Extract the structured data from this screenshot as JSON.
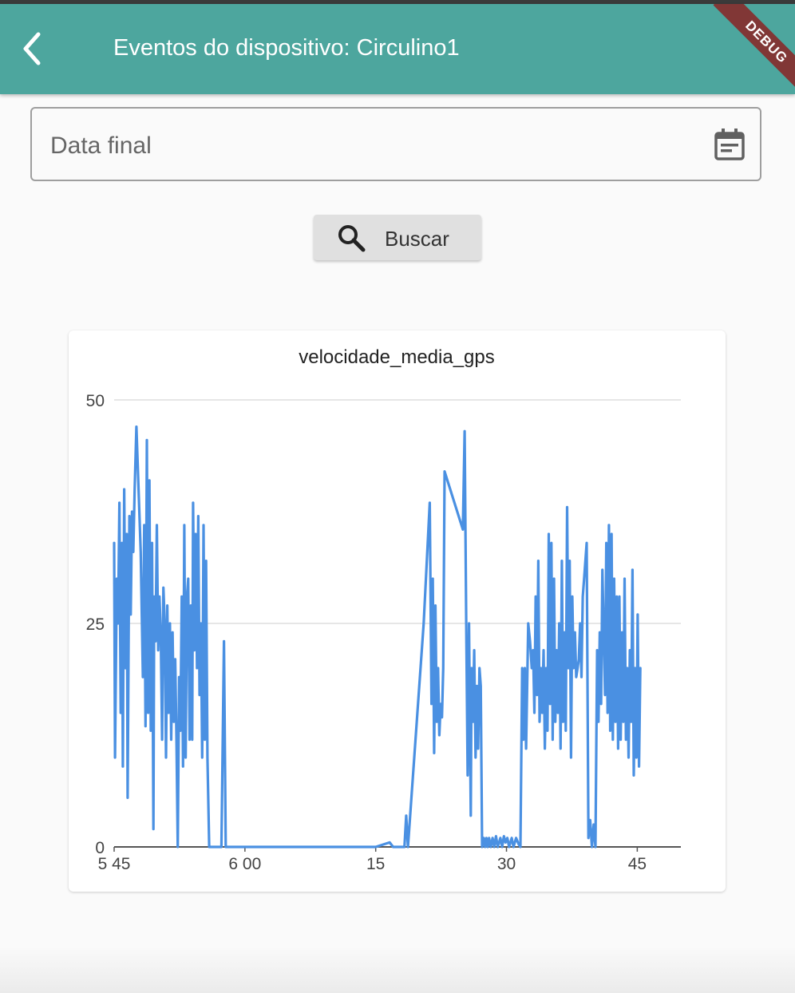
{
  "appbar": {
    "title": "Eventos do dispositivo: Circulino1",
    "back_icon": "chevron-left-icon",
    "color": "#4da69e",
    "debug_banner": "DEBUG"
  },
  "date_field": {
    "label": "Data final",
    "icon": "calendar-icon"
  },
  "search_button": {
    "label": "Buscar",
    "icon": "search-icon"
  },
  "chart_data": {
    "type": "line",
    "title": "velocidade_media_gps",
    "xlabel": "",
    "ylabel": "",
    "ylim": [
      0,
      50
    ],
    "xlim": [
      0,
      65
    ],
    "y_ticks": [
      "0",
      "25",
      "50"
    ],
    "x_ticks": [
      {
        "value": 0,
        "label": "5 45"
      },
      {
        "value": 15,
        "label": "6 00"
      },
      {
        "value": 30,
        "label": "15"
      },
      {
        "value": 45,
        "label": "30"
      },
      {
        "value": 60,
        "label": "45"
      }
    ],
    "grid": true,
    "line_color": "#4a90e2",
    "series": [
      {
        "values": [
          [
            0.0,
            34.0
          ],
          [
            0.1,
            10.0
          ],
          [
            0.3,
            30.0
          ],
          [
            0.45,
            25.0
          ],
          [
            0.6,
            38.5
          ],
          [
            0.75,
            15.0
          ],
          [
            0.9,
            34.0
          ],
          [
            1.0,
            9.0
          ],
          [
            1.15,
            40.0
          ],
          [
            1.3,
            20.0
          ],
          [
            1.45,
            35.0
          ],
          [
            1.55,
            5.5
          ],
          [
            1.75,
            37.0
          ],
          [
            1.9,
            26.0
          ],
          [
            2.05,
            37.5
          ],
          [
            2.2,
            33.0
          ],
          [
            2.35,
            40.0
          ],
          [
            2.55,
            47.0
          ],
          [
            2.8,
            40.0
          ],
          [
            3.05,
            33.0
          ],
          [
            3.3,
            19.0
          ],
          [
            3.45,
            36.0
          ],
          [
            3.6,
            13.5
          ],
          [
            3.75,
            45.5
          ],
          [
            3.9,
            15.0
          ],
          [
            4.05,
            41.0
          ],
          [
            4.2,
            13.0
          ],
          [
            4.35,
            34.0
          ],
          [
            4.5,
            2.0
          ],
          [
            4.6,
            28.0
          ],
          [
            4.75,
            23.0
          ],
          [
            4.9,
            36.0
          ],
          [
            5.05,
            22.0
          ],
          [
            5.2,
            28.0
          ],
          [
            5.35,
            24.0
          ],
          [
            5.5,
            12.0
          ],
          [
            5.65,
            29.0
          ],
          [
            5.8,
            25.0
          ],
          [
            5.95,
            10.0
          ],
          [
            6.1,
            27.0
          ],
          [
            6.25,
            15.0
          ],
          [
            6.4,
            25.0
          ],
          [
            6.55,
            12.0
          ],
          [
            6.7,
            24.0
          ],
          [
            6.85,
            14.0
          ],
          [
            7.0,
            21.0
          ],
          [
            7.15,
            12.0
          ],
          [
            7.3,
            0.0
          ],
          [
            7.45,
            19.0
          ],
          [
            7.6,
            13.0
          ],
          [
            7.75,
            28.0
          ],
          [
            7.9,
            9.0
          ],
          [
            8.05,
            36.0
          ],
          [
            8.2,
            10.0
          ],
          [
            8.35,
            28.0
          ],
          [
            8.5,
            30.0
          ],
          [
            8.65,
            12.0
          ],
          [
            8.8,
            27.0
          ],
          [
            8.95,
            12.0
          ],
          [
            9.05,
            38.5
          ],
          [
            9.2,
            22.0
          ],
          [
            9.35,
            35.0
          ],
          [
            9.5,
            20.0
          ],
          [
            9.65,
            37.0
          ],
          [
            9.8,
            17.0
          ],
          [
            9.95,
            25.0
          ],
          [
            10.1,
            10.0
          ],
          [
            10.25,
            36.0
          ],
          [
            10.4,
            12.0
          ],
          [
            10.55,
            32.0
          ],
          [
            10.7,
            10.0
          ],
          [
            10.9,
            0.0
          ],
          [
            11.4,
            0.0
          ],
          [
            11.7,
            0.0
          ],
          [
            12.0,
            0.0
          ],
          [
            12.3,
            0.0
          ],
          [
            12.6,
            23.0
          ],
          [
            12.8,
            0.0
          ],
          [
            13.5,
            0.0
          ],
          [
            16.0,
            0.0
          ],
          [
            20.0,
            0.0
          ],
          [
            25.0,
            0.0
          ],
          [
            29.0,
            0.0
          ],
          [
            30.0,
            0.0
          ],
          [
            31.6,
            0.5
          ],
          [
            32.0,
            0.0
          ],
          [
            33.3,
            0.0
          ],
          [
            33.5,
            3.5
          ],
          [
            33.7,
            0.0
          ],
          [
            35.5,
            25.0
          ],
          [
            36.2,
            38.5
          ],
          [
            36.4,
            16.0
          ],
          [
            36.55,
            30.0
          ],
          [
            36.7,
            10.5
          ],
          [
            36.85,
            27.0
          ],
          [
            37.0,
            14.0
          ],
          [
            37.15,
            20.0
          ],
          [
            37.3,
            12.5
          ],
          [
            37.45,
            16.0
          ],
          [
            37.6,
            14.5
          ],
          [
            37.75,
            20.0
          ],
          [
            37.9,
            42.0
          ],
          [
            40.0,
            35.5
          ],
          [
            40.2,
            46.5
          ],
          [
            40.4,
            23.0
          ],
          [
            40.55,
            8.0
          ],
          [
            40.7,
            25.0
          ],
          [
            40.9,
            3.5
          ],
          [
            41.0,
            20.0
          ],
          [
            41.15,
            14.0
          ],
          [
            41.3,
            22.0
          ],
          [
            41.45,
            10.0
          ],
          [
            41.6,
            18.0
          ],
          [
            41.75,
            11.0
          ],
          [
            41.9,
            20.0
          ],
          [
            42.05,
            18.0
          ],
          [
            42.2,
            0.0
          ],
          [
            42.4,
            1.0
          ],
          [
            42.55,
            0.0
          ],
          [
            42.7,
            1.0
          ],
          [
            42.85,
            0.0
          ],
          [
            43.0,
            1.0
          ],
          [
            43.2,
            0.0
          ],
          [
            43.4,
            1.0
          ],
          [
            43.6,
            0.0
          ],
          [
            43.8,
            1.2
          ],
          [
            44.0,
            0.0
          ],
          [
            44.3,
            1.0
          ],
          [
            44.5,
            0.0
          ],
          [
            44.7,
            1.2
          ],
          [
            44.9,
            0.5
          ],
          [
            45.1,
            1.0
          ],
          [
            45.3,
            0.0
          ],
          [
            45.6,
            1.0
          ],
          [
            45.8,
            0.0
          ],
          [
            46.1,
            1.0
          ],
          [
            46.4,
            0.3
          ],
          [
            46.6,
            0.0
          ],
          [
            46.8,
            20.0
          ],
          [
            46.95,
            12.0
          ],
          [
            47.1,
            20.0
          ],
          [
            47.25,
            11.0
          ],
          [
            47.5,
            25.0
          ],
          [
            47.7,
            23.0
          ],
          [
            47.9,
            20.0
          ],
          [
            48.05,
            22.0
          ],
          [
            48.2,
            15.0
          ],
          [
            48.35,
            28.0
          ],
          [
            48.5,
            17.0
          ],
          [
            48.65,
            32.0
          ],
          [
            48.8,
            14.0
          ],
          [
            48.95,
            20.0
          ],
          [
            49.1,
            15.0
          ],
          [
            49.25,
            22.0
          ],
          [
            49.4,
            11.0
          ],
          [
            49.55,
            20.0
          ],
          [
            49.7,
            13.0
          ],
          [
            49.85,
            35.0
          ],
          [
            50.0,
            16.0
          ],
          [
            50.15,
            34.0
          ],
          [
            50.3,
            12.0
          ],
          [
            50.45,
            30.0
          ],
          [
            50.6,
            14.0
          ],
          [
            50.75,
            22.0
          ],
          [
            50.9,
            15.0
          ],
          [
            51.05,
            25.0
          ],
          [
            51.2,
            11.0
          ],
          [
            51.35,
            32.0
          ],
          [
            51.5,
            14.0
          ],
          [
            51.65,
            24.0
          ],
          [
            51.8,
            13.0
          ],
          [
            51.95,
            38.0
          ],
          [
            52.1,
            20.0
          ],
          [
            52.25,
            32.0
          ],
          [
            52.4,
            10.0
          ],
          [
            52.55,
            28.0
          ],
          [
            52.7,
            20.0
          ],
          [
            52.85,
            24.0
          ],
          [
            53.0,
            19.0
          ],
          [
            53.15,
            20.0
          ],
          [
            53.3,
            21.0
          ],
          [
            53.45,
            25.0
          ],
          [
            53.6,
            19.0
          ],
          [
            53.75,
            28.0
          ],
          [
            53.9,
            30.0
          ],
          [
            54.05,
            32.0
          ],
          [
            54.2,
            34.0
          ],
          [
            54.4,
            1.0
          ],
          [
            54.6,
            3.0
          ],
          [
            54.8,
            0.0
          ],
          [
            55.0,
            2.5
          ],
          [
            55.2,
            0.0
          ],
          [
            55.4,
            22.0
          ],
          [
            55.55,
            14.0
          ],
          [
            55.7,
            24.0
          ],
          [
            55.85,
            16.0
          ],
          [
            56.0,
            31.0
          ],
          [
            56.15,
            24.0
          ],
          [
            56.3,
            17.0
          ],
          [
            56.45,
            34.0
          ],
          [
            56.6,
            15.0
          ],
          [
            56.75,
            36.0
          ],
          [
            56.9,
            13.0
          ],
          [
            57.05,
            35.0
          ],
          [
            57.2,
            12.0
          ],
          [
            57.35,
            30.0
          ],
          [
            57.5,
            14.0
          ],
          [
            57.65,
            28.0
          ],
          [
            57.8,
            11.0
          ],
          [
            57.95,
            28.0
          ],
          [
            58.1,
            12.0
          ],
          [
            58.25,
            24.0
          ],
          [
            58.4,
            14.0
          ],
          [
            58.55,
            30.0
          ],
          [
            58.7,
            12.0
          ],
          [
            58.85,
            20.0
          ],
          [
            59.0,
            10.0
          ],
          [
            59.15,
            22.0
          ],
          [
            59.3,
            14.0
          ],
          [
            59.45,
            31.0
          ],
          [
            59.6,
            8.0
          ],
          [
            59.75,
            20.0
          ],
          [
            59.9,
            10.0
          ],
          [
            60.05,
            26.0
          ],
          [
            60.2,
            9.0
          ],
          [
            60.35,
            20.0
          ]
        ]
      }
    ]
  }
}
